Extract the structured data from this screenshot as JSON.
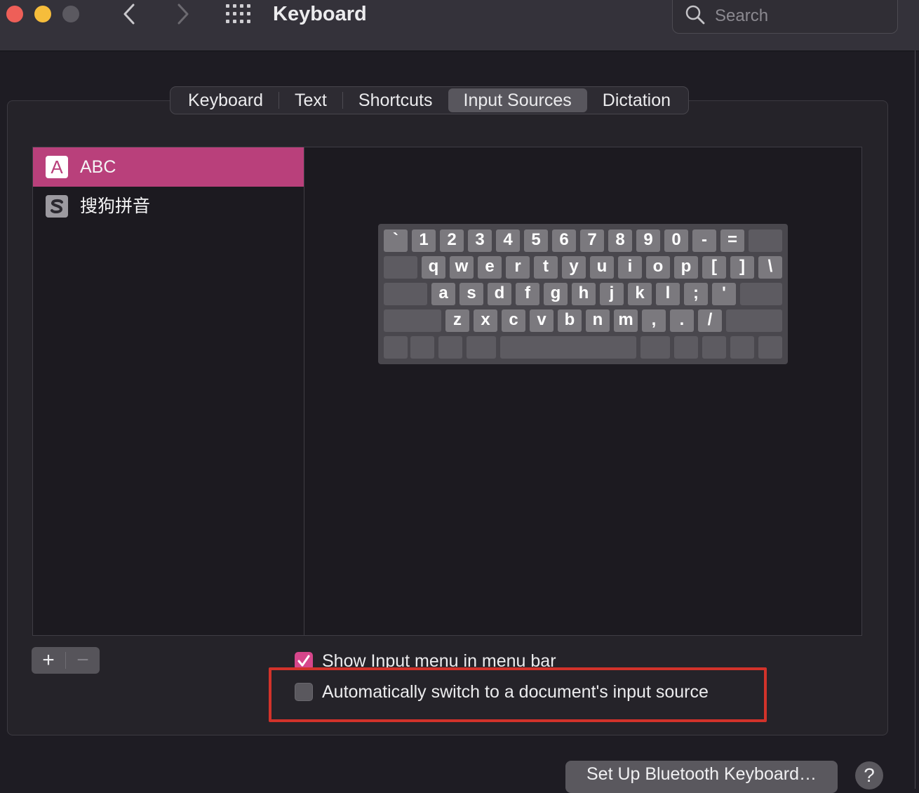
{
  "window": {
    "title": "Keyboard",
    "search_placeholder": "Search",
    "nav_icons": [
      "chevron-left-icon",
      "chevron-right-icon",
      "grid-icon"
    ]
  },
  "tabs": [
    {
      "label": "Keyboard",
      "active": false
    },
    {
      "label": "Text",
      "active": false
    },
    {
      "label": "Shortcuts",
      "active": false
    },
    {
      "label": "Input Sources",
      "active": true
    },
    {
      "label": "Dictation",
      "active": false
    }
  ],
  "input_sources": [
    {
      "label": "ABC",
      "icon_letter": "A",
      "selected": true
    },
    {
      "label": "搜狗拼音",
      "icon": "sogou-icon",
      "selected": false
    }
  ],
  "keyboard_preview": {
    "rows": [
      [
        "`",
        "1",
        "2",
        "3",
        "4",
        "5",
        "6",
        "7",
        "8",
        "9",
        "0",
        "-",
        "="
      ],
      [
        "q",
        "w",
        "e",
        "r",
        "t",
        "y",
        "u",
        "i",
        "o",
        "p",
        "[",
        "]",
        "\\"
      ],
      [
        "a",
        "s",
        "d",
        "f",
        "g",
        "h",
        "j",
        "k",
        "l",
        ";",
        "'"
      ],
      [
        "z",
        "x",
        "c",
        "v",
        "b",
        "n",
        "m",
        ",",
        ".",
        "/"
      ]
    ]
  },
  "list_controls": {
    "add_label": "+",
    "remove_label": "−"
  },
  "options": {
    "show_input_menu": {
      "label": "Show Input menu in menu bar",
      "checked": true
    },
    "auto_switch": {
      "label": "Automatically switch to a document's input source",
      "checked": false
    }
  },
  "buttons": {
    "bluetooth": "Set Up Bluetooth Keyboard…",
    "help": "?"
  },
  "colors": {
    "accent": "#b9407b",
    "checkbox_checked": "#d6468b",
    "highlight_box": "#d2322a"
  }
}
